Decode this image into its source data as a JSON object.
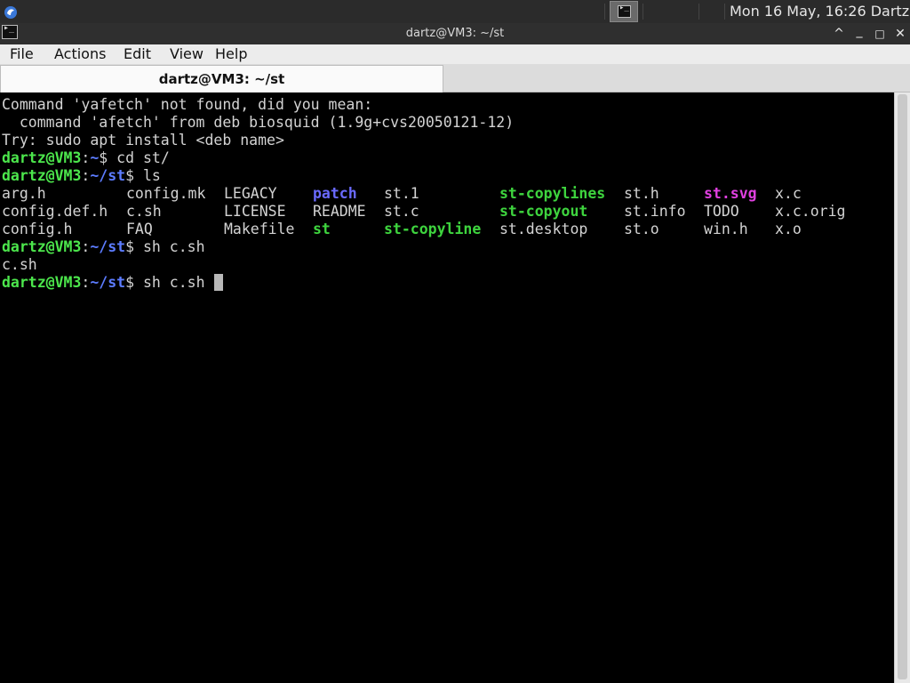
{
  "panel": {
    "clock": "Mon 16 May, 16:26",
    "user": "Dartz"
  },
  "window": {
    "title": "dartz@VM3: ~/st",
    "buttons": {
      "collapse": "^",
      "minimize": "_",
      "maximize": "□",
      "close": "✕"
    }
  },
  "menubar": [
    "File",
    "Actions",
    "Edit",
    "View",
    "Help"
  ],
  "tab": {
    "label": "dartz@VM3: ~/st"
  },
  "terminal": {
    "lines": [
      {
        "text": "Command 'yafetch' not found, did you mean:"
      },
      {
        "text": "  command 'afetch' from deb biosquid (1.9g+cvs20050121-12)"
      },
      {
        "text": "Try: sudo apt install <deb name>"
      },
      {
        "prompt": {
          "user": "dartz@VM3",
          "path": "~"
        },
        "cmd": " cd st/"
      },
      {
        "prompt": {
          "user": "dartz@VM3",
          "path": "~/st"
        },
        "cmd": " ls"
      }
    ],
    "ls_columns": [
      0,
      140,
      250,
      350,
      430,
      560,
      700,
      790,
      870
    ],
    "ls_rows": [
      [
        {
          "name": "arg.h",
          "kind": "norm"
        },
        {
          "name": "config.mk",
          "kind": "norm"
        },
        {
          "name": "LEGACY",
          "kind": "norm"
        },
        {
          "name": "patch",
          "kind": "dir"
        },
        {
          "name": "st.1",
          "kind": "norm"
        },
        {
          "name": "st-copylines",
          "kind": "exe"
        },
        {
          "name": "st.h",
          "kind": "norm"
        },
        {
          "name": "st.svg",
          "kind": "img"
        },
        {
          "name": "x.c",
          "kind": "norm"
        }
      ],
      [
        {
          "name": "config.def.h",
          "kind": "norm"
        },
        {
          "name": "c.sh",
          "kind": "norm"
        },
        {
          "name": "LICENSE",
          "kind": "norm"
        },
        {
          "name": "README",
          "kind": "norm"
        },
        {
          "name": "st.c",
          "kind": "norm"
        },
        {
          "name": "st-copyout",
          "kind": "exe"
        },
        {
          "name": "st.info",
          "kind": "norm"
        },
        {
          "name": "TODO",
          "kind": "norm"
        },
        {
          "name": "x.c.orig",
          "kind": "norm"
        }
      ],
      [
        {
          "name": "config.h",
          "kind": "norm"
        },
        {
          "name": "FAQ",
          "kind": "norm"
        },
        {
          "name": "Makefile",
          "kind": "norm"
        },
        {
          "name": "st",
          "kind": "exe"
        },
        {
          "name": "st-copyline",
          "kind": "exe"
        },
        {
          "name": "st.desktop",
          "kind": "norm"
        },
        {
          "name": "st.o",
          "kind": "norm"
        },
        {
          "name": "win.h",
          "kind": "norm"
        },
        {
          "name": "x.o",
          "kind": "norm"
        }
      ]
    ],
    "after": [
      {
        "prompt": {
          "user": "dartz@VM3",
          "path": "~/st"
        },
        "cmd": " sh c.sh"
      },
      {
        "text": "c.sh"
      },
      {
        "prompt": {
          "user": "dartz@VM3",
          "path": "~/st"
        },
        "cmd": " sh c.sh ",
        "cursor": true
      }
    ]
  },
  "colors": {
    "prompt_user": "#4ce64c",
    "prompt_path": "#5c7cff",
    "directory": "#6a6aff",
    "executable": "#3ed43e",
    "image": "#e040e0",
    "text": "#d3d3d3",
    "background": "#000000"
  }
}
